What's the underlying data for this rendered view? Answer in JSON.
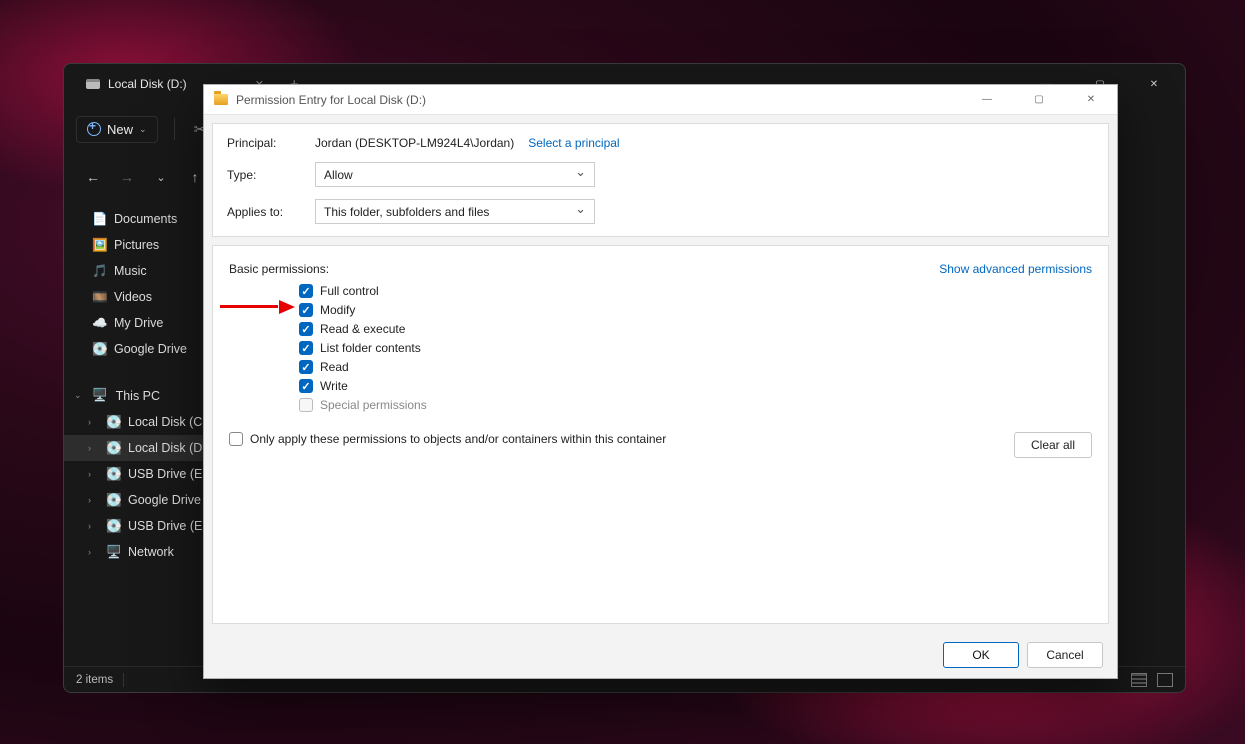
{
  "explorer": {
    "title": "Local Disk (D:)",
    "new_label": "New",
    "nav_arrows": {
      "back": "←",
      "forward": "→",
      "up": "↑",
      "recent": "⌄"
    },
    "sidebar": {
      "quick": [
        {
          "label": "Documents",
          "icon": "📄",
          "pinned": true
        },
        {
          "label": "Pictures",
          "icon": "🖼️",
          "pinned": true
        },
        {
          "label": "Music",
          "icon": "🎵",
          "pinned": true
        },
        {
          "label": "Videos",
          "icon": "🎞️",
          "pinned": true
        },
        {
          "label": "My Drive",
          "icon": "☁️",
          "pinned": true
        },
        {
          "label": "Google Drive",
          "icon": "💽",
          "pinned": true
        }
      ],
      "thispc_label": "This PC",
      "drives": [
        {
          "label": "Local Disk (C:)",
          "icon": "💽"
        },
        {
          "label": "Local Disk (D:)",
          "icon": "💽",
          "selected": true
        },
        {
          "label": "USB Drive (E:)",
          "icon": "💽"
        },
        {
          "label": "Google Drive (G:)",
          "icon": "💽"
        },
        {
          "label": "USB Drive (E:)",
          "icon": "💽"
        },
        {
          "label": "Network",
          "icon": "🖥️"
        }
      ]
    },
    "status": "2 items"
  },
  "dialog": {
    "title": "Permission Entry for Local Disk (D:)",
    "labels": {
      "principal": "Principal:",
      "type": "Type:",
      "applies_to": "Applies to:",
      "basic_perms": "Basic permissions:",
      "show_advanced": "Show advanced permissions",
      "only_apply": "Only apply these permissions to objects and/or containers within this container",
      "clear_all": "Clear all",
      "select_principal": "Select a principal",
      "ok": "OK",
      "cancel": "Cancel"
    },
    "principal_value": "Jordan (DESKTOP-LM924L4\\Jordan)",
    "type_value": "Allow",
    "applies_value": "This folder, subfolders and files",
    "permissions": [
      {
        "label": "Full control",
        "checked": true
      },
      {
        "label": "Modify",
        "checked": true
      },
      {
        "label": "Read & execute",
        "checked": true
      },
      {
        "label": "List folder contents",
        "checked": true
      },
      {
        "label": "Read",
        "checked": true
      },
      {
        "label": "Write",
        "checked": true
      },
      {
        "label": "Special permissions",
        "checked": false,
        "disabled": true
      }
    ],
    "only_apply_checked": false
  }
}
